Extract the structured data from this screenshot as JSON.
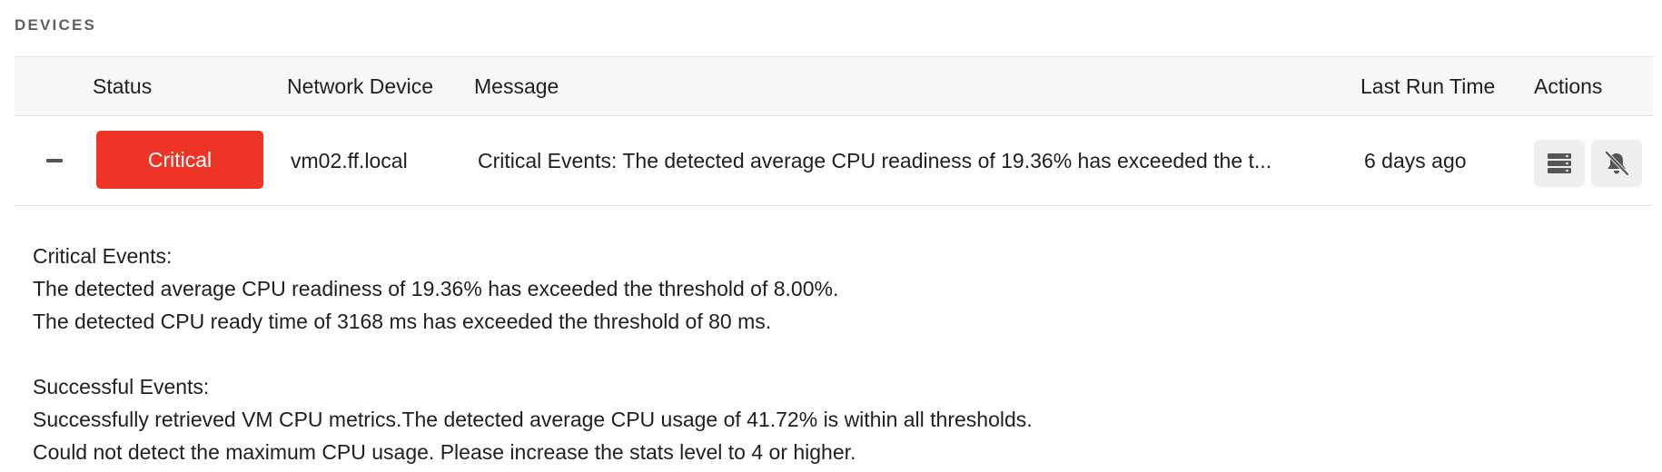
{
  "section": {
    "title": "DEVICES"
  },
  "table": {
    "headers": {
      "status": "Status",
      "device": "Network Device",
      "message": "Message",
      "last_run": "Last Run Time",
      "actions": "Actions"
    },
    "rows": [
      {
        "status": "Critical",
        "status_color": "#ee3424",
        "device": "vm02.ff.local",
        "message": "Critical Events: The detected average CPU readiness of 19.36% has exceeded the t...",
        "last_run": "6 days ago",
        "actions": [
          "list-icon",
          "bell-off-icon"
        ]
      }
    ]
  },
  "details": {
    "critical_heading": "Critical Events:",
    "critical_lines": [
      "The detected average CPU readiness of 19.36% has exceeded the threshold of 8.00%.",
      "The detected CPU ready time of 3168 ms has exceeded the threshold of 80 ms."
    ],
    "success_heading": "Successful Events:",
    "success_lines": [
      "Successfully retrieved VM CPU metrics.The detected average CPU usage of 41.72% is within all thresholds.",
      "Could not detect the maximum CPU usage. Please increase the stats level to 4 or higher."
    ]
  }
}
